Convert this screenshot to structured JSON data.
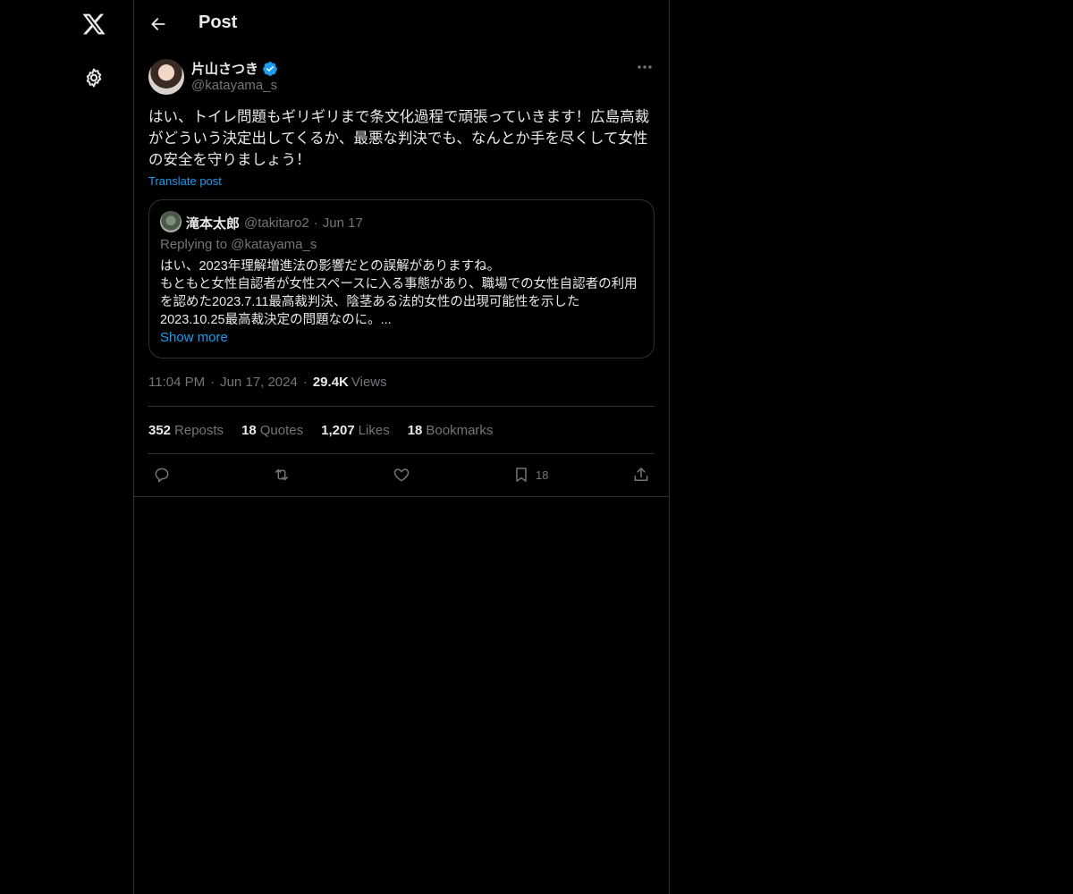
{
  "header": {
    "title": "Post"
  },
  "sidebar": {
    "logo_icon": "x-logo-icon",
    "settings_icon": "gear-icon"
  },
  "post": {
    "author": {
      "display_name": "片山さつき",
      "handle": "@katayama_s",
      "verified": true
    },
    "text": "はい、トイレ問題もギリギリまで条文化過程で頑張っていきます！広島高裁がどういう決定出してくるか、最悪な判決でも、なんとか手を尽くして女性の安全を守りましょう！",
    "translate_label": "Translate post",
    "quote": {
      "display_name": "滝本太郎",
      "handle": "@takitaro2",
      "dot": "·",
      "date": "Jun 17",
      "replying_to": "Replying to @katayama_s",
      "text": "はい、2023年理解増進法の影響だとの誤解がありますね。\nもともと女性自認者が女性スペースに入る事態があり、職場での女性自認者の利用を認めた2023.7.11最高裁判決、陰茎ある法的女性の出現可能性を示した2023.10.25最高裁決定の問題なのに。...",
      "show_more": "Show more"
    },
    "meta": {
      "time": "11:04 PM",
      "dot": "·",
      "date": "Jun 17, 2024",
      "views_count": "29.4K",
      "views_label": "Views"
    },
    "stats": [
      {
        "count": "352",
        "label": "Reposts"
      },
      {
        "count": "18",
        "label": "Quotes"
      },
      {
        "count": "1,207",
        "label": "Likes"
      },
      {
        "count": "18",
        "label": "Bookmarks"
      }
    ],
    "actions": {
      "reply_icon": "reply-icon",
      "repost_icon": "repost-icon",
      "like_icon": "heart-icon",
      "bookmark_icon": "bookmark-icon",
      "bookmark_count": "18",
      "share_icon": "share-icon"
    }
  },
  "colors": {
    "accent": "#1d9bf0",
    "background": "#000000",
    "muted": "#71767b",
    "border": "#2f3336"
  }
}
